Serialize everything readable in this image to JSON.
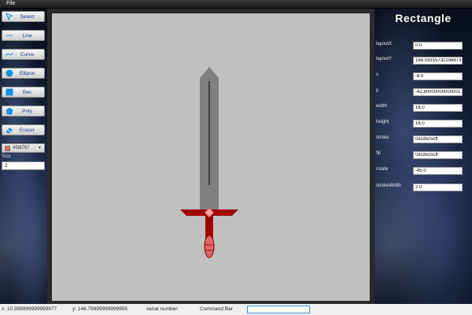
{
  "menu": {
    "file_label": "File"
  },
  "toolbar": {
    "tools": [
      {
        "label": "Select",
        "icon": "select-arrow-icon"
      },
      {
        "label": "Line",
        "icon": "line-icon"
      },
      {
        "label": "Curve",
        "icon": "curve-icon"
      },
      {
        "label": "Ellipse",
        "icon": "ellipse-icon"
      },
      {
        "label": "Rec",
        "icon": "rectangle-icon"
      },
      {
        "label": "Poly",
        "icon": "polygon-icon"
      },
      {
        "label": "Eraser",
        "icon": "eraser-icon"
      }
    ],
    "color_value": "#f36767",
    "width_label": "Size",
    "width_value": "2",
    "accent": "#1a8fe0"
  },
  "panel": {
    "title": "Rectangle",
    "properties": [
      {
        "label": "layoutX",
        "value": "0.0"
      },
      {
        "label": "layoutY",
        "value": "164.03315732256873"
      },
      {
        "label": "x",
        "value": "-8.0"
      },
      {
        "label": "y",
        "value": "-42.80000000000001"
      },
      {
        "label": "width",
        "value": "16.0"
      },
      {
        "label": "height",
        "value": "16.0"
      },
      {
        "label": "stroke",
        "value": "0xcd5c5cff"
      },
      {
        "label": "fill",
        "value": "0xcd5c5cff"
      },
      {
        "label": "rotate",
        "value": "-45.0"
      },
      {
        "label": "strokeWidth",
        "value": "2.0"
      }
    ]
  },
  "status": {
    "x_readout": "x: 10.399999999999977",
    "y_readout": "y: 146.79999999999995",
    "serial_label": "serial number:",
    "command_label": "Command Bar",
    "command_value": ""
  },
  "colors": {
    "blade": "#808080",
    "guard": "#8b0000",
    "handle": "#a00000",
    "gem": "#f4a4a4",
    "pommel": "#e06767"
  }
}
